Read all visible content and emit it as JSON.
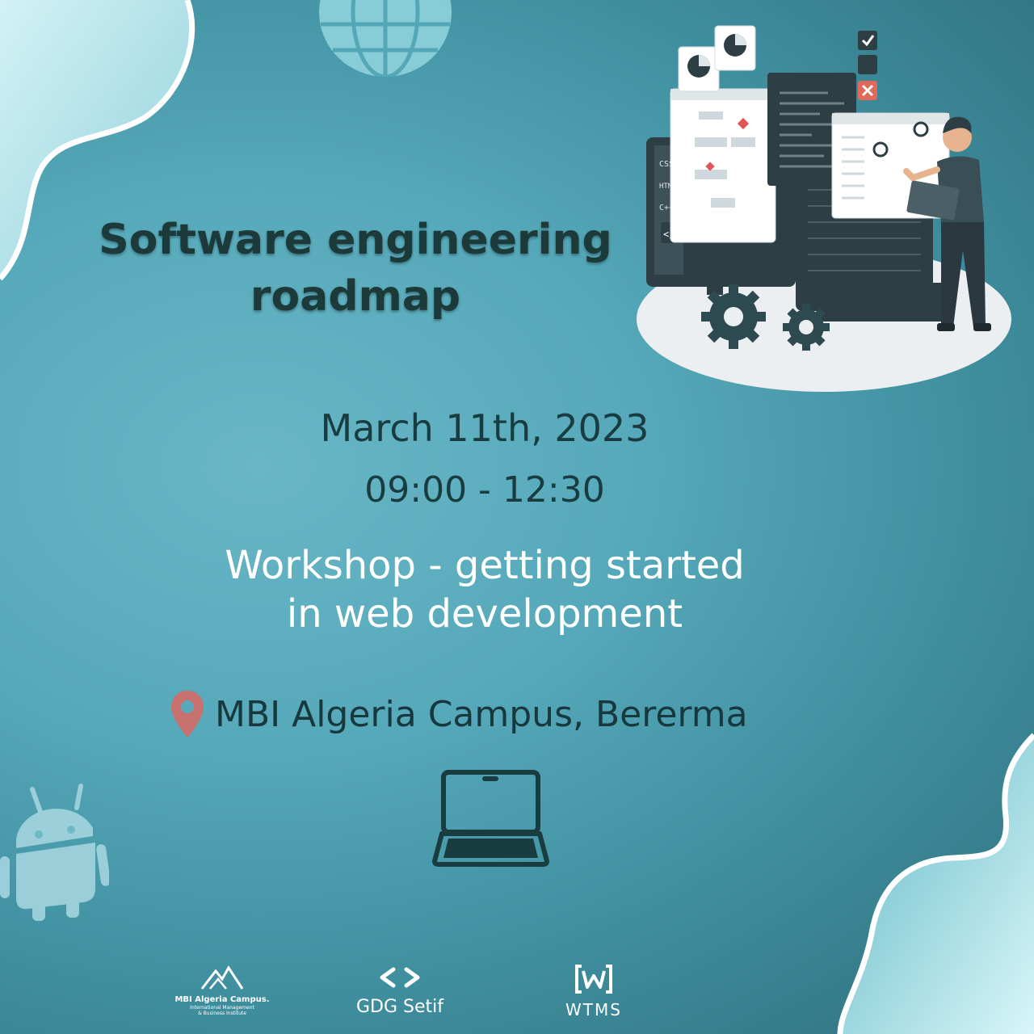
{
  "title": {
    "line1": "Software engineering",
    "line2": "roadmap"
  },
  "event": {
    "date": "March 11th, 2023",
    "time": "09:00 - 12:30",
    "workshop_line1": "Workshop - getting started",
    "workshop_line2": "in web development"
  },
  "location": {
    "text": "MBI Algeria Campus, Bererma",
    "icon": "map-pin-icon"
  },
  "illustration": {
    "side_labels": [
      "CSS",
      "HTML",
      "C++"
    ],
    "code_tag": "</>"
  },
  "icons": [
    "globe-icon",
    "android-icon",
    "laptop-icon",
    "gear-icon",
    "map-pin-icon"
  ],
  "logos": {
    "mbi": {
      "name": "MBI Algeria Campus.",
      "sub1": "International Management",
      "sub2": "& Business Institute"
    },
    "gdg": {
      "mark": "< >",
      "name": "GDG Setif"
    },
    "wtms": {
      "mark": "W",
      "name": "WTMS"
    }
  },
  "colors": {
    "background": "#56a9ba",
    "title_text": "#1c3a3a",
    "body_text": "#183c40",
    "workshop_text": "#ffffff",
    "pin": "#c8716f",
    "wave": "#ffffff"
  }
}
